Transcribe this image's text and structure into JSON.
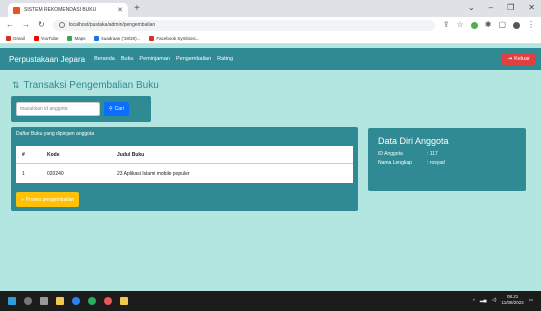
{
  "browser": {
    "tab_title": "SISTEM REKOMENDASI BUKU",
    "url": "localhost/pustaka/admin/pengembalian",
    "bookmarks": [
      {
        "label": "Gmail",
        "color": "#d93025"
      },
      {
        "label": "YouTube",
        "color": "#ff0000"
      },
      {
        "label": "Maps",
        "color": "#34a853"
      },
      {
        "label": "kuadraan ('19/20)...",
        "color": "#1a73e8"
      },
      {
        "label": "Facebook Symbiosi...",
        "color": "#d93025"
      }
    ]
  },
  "navbar": {
    "brand": "Perpustakaan Jepara",
    "links": [
      "Beranda",
      "Buku",
      "Peminjaman",
      "Pengembalian",
      "Rating"
    ],
    "logout_label": "Keluar"
  },
  "page": {
    "heading": "Transaksi Pengembalian Buku"
  },
  "search": {
    "placeholder": "masukkan id anggota",
    "button_label": "Cari"
  },
  "borrowed": {
    "caption": "Daftar Buku yang dipinjam anggota",
    "columns": [
      "#",
      "Kode",
      "Judul Buku"
    ],
    "rows": [
      {
        "no": "1",
        "kode": "020240",
        "judul": "23 Aplikasi Islami mobile populer"
      }
    ],
    "process_button": "Proses pengembalian"
  },
  "member": {
    "title": "Data Diri Anggota",
    "fields": [
      {
        "label": "ID Anggota",
        "value": ": 117"
      },
      {
        "label": "Nama Lengkap",
        "value": ": rosyad"
      }
    ]
  },
  "taskbar": {
    "time": "08.21",
    "date": "11/08/2022"
  },
  "colors": {
    "accent": "#2f8a94",
    "background": "#b3e5e1",
    "danger": "#e0403f",
    "warning": "#ffc107",
    "primary": "#0d6efd"
  }
}
